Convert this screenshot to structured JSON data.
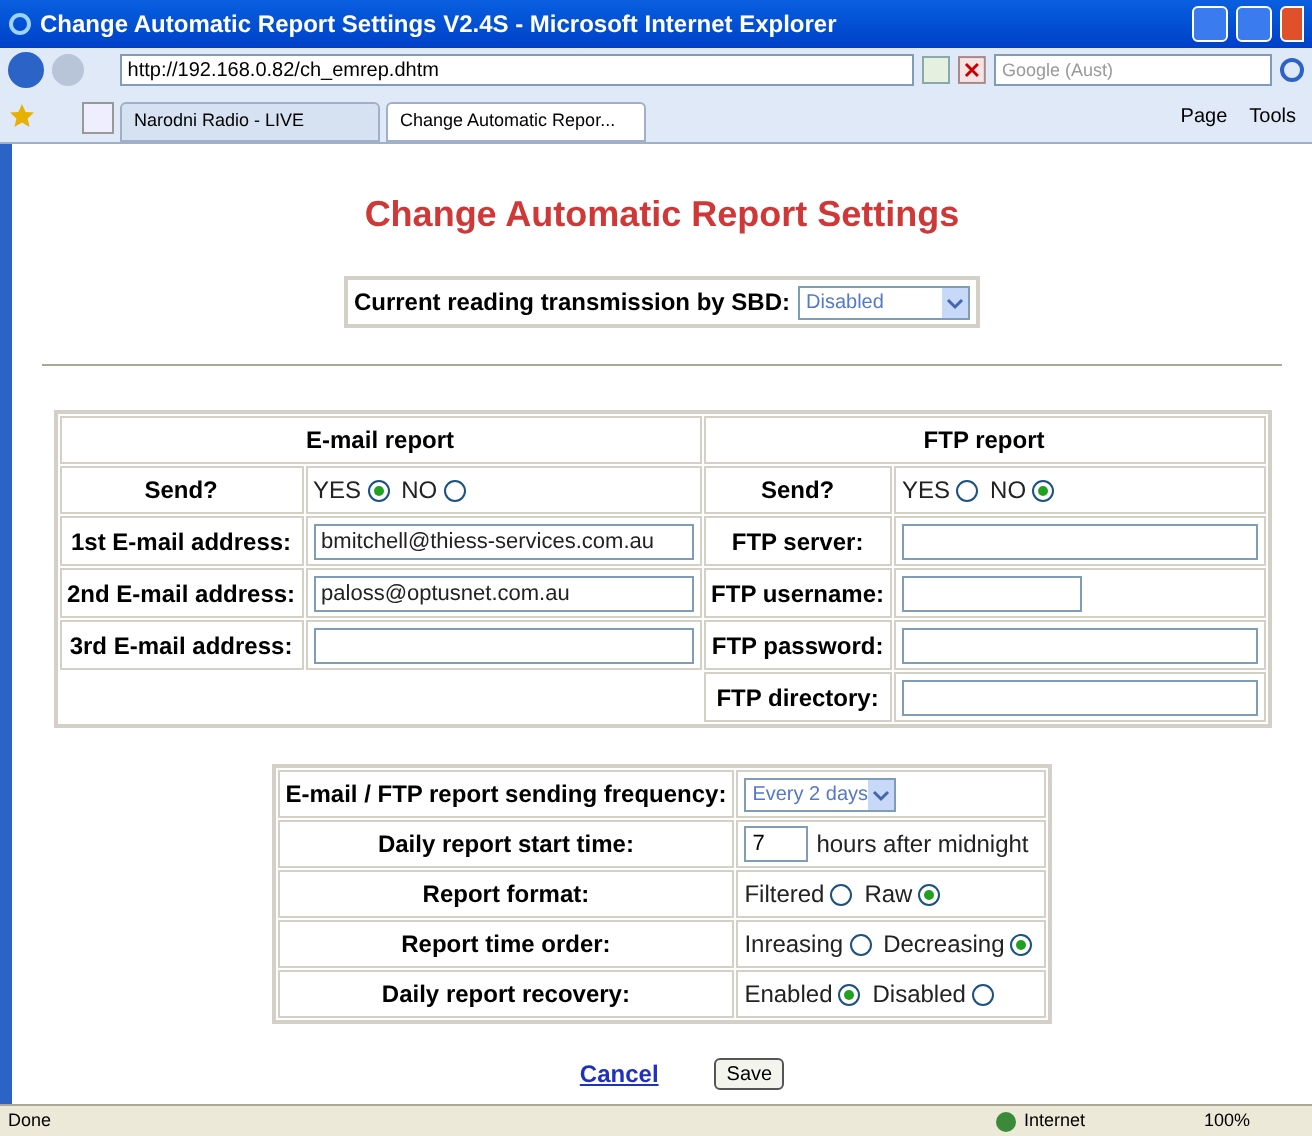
{
  "window": {
    "title": "Change Automatic Report Settings V2.4S - Microsoft Internet Explorer"
  },
  "address_bar": {
    "url": "http://192.168.0.82/ch_emrep.dhtm"
  },
  "search": {
    "placeholder": "Google (Aust)"
  },
  "tabs": [
    {
      "label": "Narodni Radio - LIVE",
      "selected": false
    },
    {
      "label": "Change Automatic Repor...",
      "selected": true
    }
  ],
  "toolbar": [
    "Page",
    "Tools"
  ],
  "page": {
    "heading": "Change Automatic Report Settings",
    "sbd": {
      "label": "Current reading transmission by SBD:",
      "value": "Disabled"
    },
    "email": {
      "heading": "E-mail report",
      "send_label": "Send?",
      "options": [
        {
          "label": "YES",
          "selected": true
        },
        {
          "label": "NO",
          "selected": false
        }
      ],
      "fields": [
        {
          "label": "1st E-mail address:",
          "value": "bmitchell@thiess-services.com.au",
          "kind": "wide"
        },
        {
          "label": "2nd E-mail address:",
          "value": "paloss@optusnet.com.au",
          "kind": "wide"
        },
        {
          "label": "3rd E-mail address:",
          "kind": "wide"
        }
      ]
    },
    "ftp": {
      "heading": "FTP report",
      "send_label": "Send?",
      "options": [
        {
          "label": "YES",
          "selected": false
        },
        {
          "label": "NO",
          "selected": true
        }
      ],
      "fields": [
        {
          "label": "FTP server:",
          "kind": "wide"
        },
        {
          "label": "FTP username:",
          "kind": "short"
        },
        {
          "label": "FTP password:",
          "kind": "wide"
        },
        {
          "label": "FTP directory:",
          "kind": "wide"
        }
      ]
    },
    "settings": [
      {
        "kind": "select",
        "label": "E-mail / FTP report sending frequency:",
        "value": "Every 2 days"
      },
      {
        "kind": "text",
        "label": "Daily report start time:",
        "value": "7",
        "suffix": "hours after midnight"
      },
      {
        "kind": "radio",
        "label": "Report format:",
        "options": [
          {
            "label": "Filtered",
            "selected": false
          },
          {
            "label": "Raw",
            "selected": true
          }
        ]
      },
      {
        "kind": "radio",
        "label": "Report time order:",
        "options": [
          {
            "label": "Inreasing",
            "selected": false
          },
          {
            "label": "Decreasing",
            "selected": true
          }
        ]
      },
      {
        "kind": "radio",
        "label": "Daily report recovery:",
        "options": [
          {
            "label": "Enabled",
            "selected": true
          },
          {
            "label": "Disabled",
            "selected": false
          }
        ]
      }
    ],
    "cancel": "Cancel",
    "save": "Save"
  },
  "status_bar": {
    "text": "Done",
    "zone": "Internet",
    "zoom": "100%"
  }
}
